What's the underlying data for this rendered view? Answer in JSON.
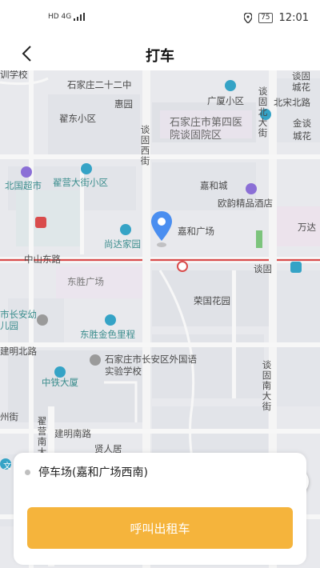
{
  "status_bar": {
    "network": "HD 4G",
    "battery": "75",
    "time": "12:01"
  },
  "header": {
    "title": "打车"
  },
  "map": {
    "labels": {
      "school_top": "训学校",
      "shijiazhuang_22": "石家庄二十二中",
      "guangxia": "广厦小区",
      "tangu_north": "谈固北大街",
      "beisong_road": "北宋北路",
      "tangu_city": "谈固城花",
      "huiyuan": "惠园",
      "zhaidong": "翟东小区",
      "hospital": "石家庄市第四医院谈固院区",
      "jinsong": "金谈城花",
      "tangu_west": "谈固西街",
      "beiguo": "北国超市",
      "zhaiying": "翟营大街小区",
      "jiahecheng": "嘉和城",
      "ouyun": "欧韵精品酒店",
      "wanda": "万达",
      "shangda": "尚达家园",
      "jiahe_plaza": "嘉和广场",
      "zhongshan_east": "中山东路",
      "tangu": "谈固",
      "dongsheng_plaza": "东胜广场",
      "rongguo": "荣国花园",
      "changan_kindergarten": "市长安幼儿园",
      "dongsheng_jinse": "东胜金色里程",
      "jianming_north": "建明北路",
      "foreign_school": "石家庄市长安区外国语实验学校",
      "zhongtie": "中铁大厦",
      "tangu_south": "谈固南大街",
      "zhou_street": "州街",
      "zhaiying_south": "翟营南大街",
      "jianming_south": "建明南路",
      "xianren": "贤人居",
      "wen": "文"
    }
  },
  "location": {
    "name": "停车场(嘉和广场西南)"
  },
  "action": {
    "call_label": "呼叫出租车"
  },
  "colors": {
    "accent": "#f5b43c",
    "pin": "#4a8ef0",
    "road": "#d94c4c",
    "poi": "#35a3c6"
  }
}
